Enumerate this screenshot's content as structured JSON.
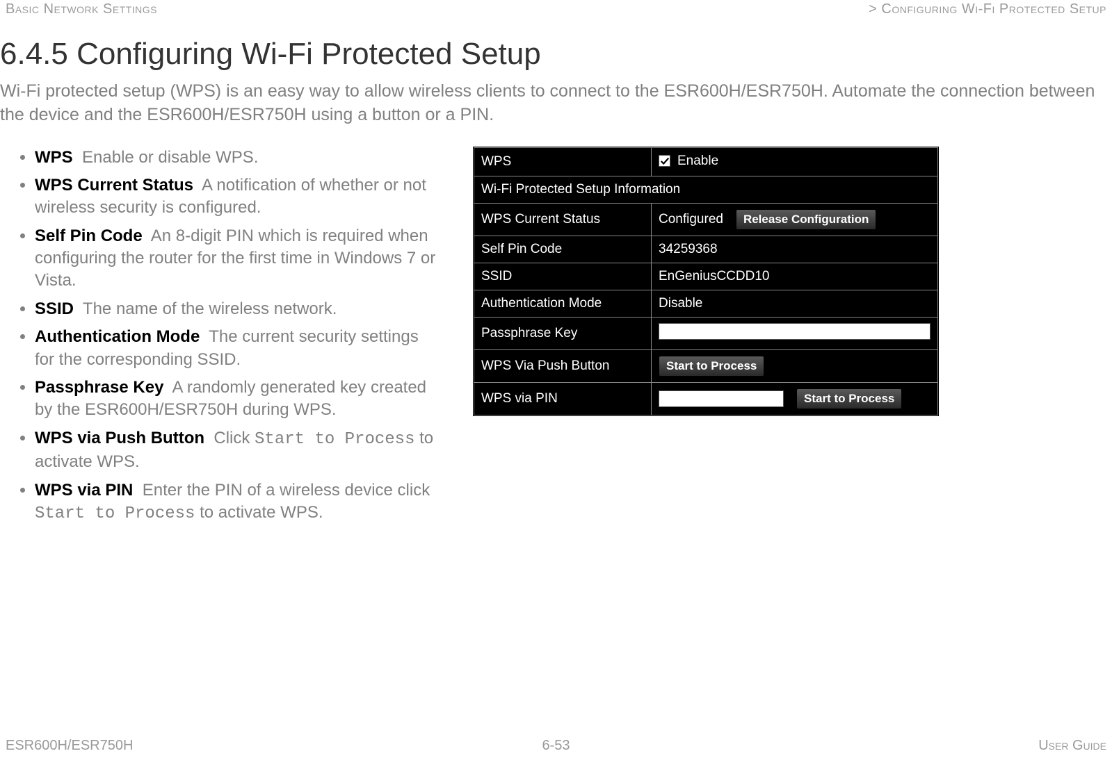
{
  "header": {
    "left": "Basic Network Settings",
    "right": "> Configuring Wi-Fi Protected Setup"
  },
  "title": "6.4.5 Configuring Wi-Fi Protected Setup",
  "lead": "Wi-Fi protected setup (WPS) is an easy way to allow wireless clients to connect to the ESR600H/ESR750H. Automate the connection between the device and the ESR600H/ESR750H using a button or a PIN.",
  "bullets": [
    {
      "term": "WPS",
      "desc": "Enable or disable WPS."
    },
    {
      "term": "WPS Current Status",
      "desc": "A notification of whether or not wireless security is configured."
    },
    {
      "term": "Self Pin Code",
      "desc": "An 8-digit PIN which is required when configuring the router for the first time in Windows 7 or Vista."
    },
    {
      "term": "SSID",
      "desc": "The name of the wireless network."
    },
    {
      "term": "Authentication Mode",
      "desc": "The current security settings for the corresponding SSID."
    },
    {
      "term": "Passphrase Key",
      "desc": "A randomly generated key created by the ESR600H/ESR750H during WPS."
    },
    {
      "term": "WPS via Push Button",
      "desc_pre": "Click ",
      "code": "Start to Process",
      "desc_post": " to activate WPS."
    },
    {
      "term": "WPS via PIN",
      "desc_pre": "Enter the PIN of a wireless device click ",
      "code": "Start to Process",
      "desc_post": " to activate WPS."
    }
  ],
  "screenshot": {
    "rows": {
      "wps_label": "WPS",
      "wps_enable": "Enable",
      "section": "Wi-Fi Protected Setup Information",
      "status_label": "WPS Current Status",
      "status_value": "Configured",
      "status_button": "Release Configuration",
      "pin_label": "Self Pin Code",
      "pin_value": "34259368",
      "ssid_label": "SSID",
      "ssid_value": "EnGeniusCCDD10",
      "auth_label": "Authentication Mode",
      "auth_value": "Disable",
      "pass_label": "Passphrase Key",
      "push_label": "WPS Via Push Button",
      "push_button": "Start to Process",
      "pinrow_label": "WPS via PIN",
      "pinrow_button": "Start to Process"
    }
  },
  "footer": {
    "left": "ESR600H/ESR750H",
    "center": "6-53",
    "right": "User Guide"
  }
}
